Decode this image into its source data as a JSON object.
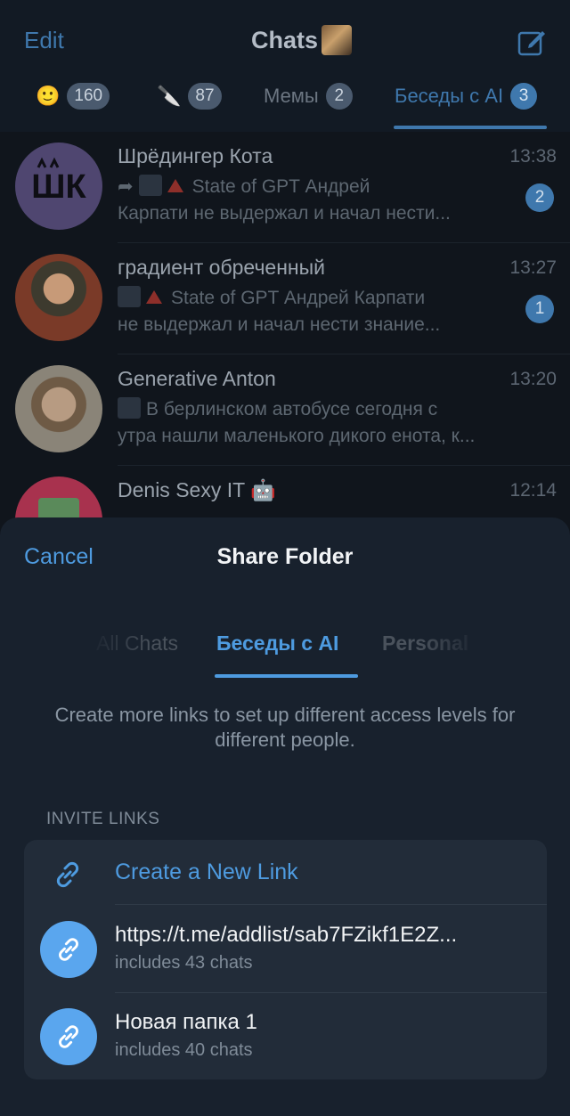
{
  "header": {
    "edit_label": "Edit",
    "title": "Chats"
  },
  "folders": [
    {
      "emoji": "🙂",
      "label": "",
      "count": "160",
      "active": false
    },
    {
      "emoji": "🔪",
      "label": "",
      "count": "87",
      "active": false
    },
    {
      "emoji": "",
      "label": "Мемы",
      "count": "2",
      "active": false
    },
    {
      "emoji": "",
      "label": "Беседы с AI",
      "count": "3",
      "active": true
    }
  ],
  "chats": [
    {
      "name": "Шрёдингер Кота",
      "time": "13:38",
      "line1": "State of GPT Андрей",
      "line2": "Карпати не выдержал и начал нести...",
      "unread": "2"
    },
    {
      "name": "градиент обреченный",
      "time": "13:27",
      "line1": "State of GPT Андрей Карпати",
      "line2": "не выдержал и начал нести знание...",
      "unread": "1"
    },
    {
      "name": "Generative Anton",
      "time": "13:20",
      "line1": "В берлинском автобусе сегодня с",
      "line2": "утра нашли маленького дикого енота, к...",
      "unread": ""
    },
    {
      "name": "Denis Sexy IT 🤖",
      "time": "12:14",
      "line1": "",
      "line2": "",
      "unread": ""
    }
  ],
  "sheet": {
    "cancel_label": "Cancel",
    "title": "Share Folder",
    "tabs": [
      "All Chats",
      "Беседы с AI",
      "Personal"
    ],
    "active_tab": "Беседы с AI",
    "hint": "Create more links to set up different access levels for different people.",
    "section_header": "INVITE LINKS",
    "create_link_label": "Create a New Link",
    "links": [
      {
        "title": "https://t.me/addlist/sab7FZikf1E2Z...",
        "subtitle": "includes 43 chats"
      },
      {
        "title": "Новая папка 1",
        "subtitle": "includes 40 chats"
      }
    ]
  },
  "colors": {
    "accent": "#4e9be0",
    "sheet_bg": "#18212d",
    "card_bg": "#222c39",
    "link_icon_bg": "#5aa6ee"
  },
  "icons": {
    "compose": "compose-icon",
    "link": "link-icon",
    "forward": "forward-icon",
    "warning": "red-triangle-icon"
  }
}
